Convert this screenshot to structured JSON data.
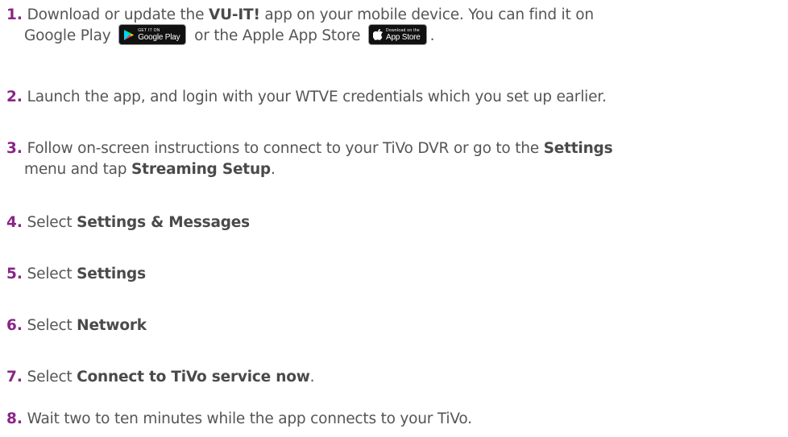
{
  "steps": [
    {
      "num": "1.",
      "t1": "Download or update the ",
      "b1": "VU-IT!",
      "t2": " app on your mobile device. You can find it on",
      "t3": "Google Play",
      "t4": "or the Apple App Store",
      "t5": "."
    },
    {
      "num": "2.",
      "t1": "Launch the app, and login with your WTVE credentials which you set up earlier."
    },
    {
      "num": "3.",
      "t1": "Follow on-screen instructions to connect to your TiVo DVR or go to the ",
      "b1": "Settings",
      "t2": "menu and tap ",
      "b2": "Streaming Setup",
      "t3": "."
    },
    {
      "num": "4.",
      "t1": "Select ",
      "b1": "Settings & Messages"
    },
    {
      "num": "5.",
      "t1": "Select ",
      "b1": "Settings"
    },
    {
      "num": "6.",
      "t1": "Select ",
      "b1": "Network"
    },
    {
      "num": "7.",
      "t1": "Select ",
      "b1": "Connect to TiVo service now",
      "t2": "."
    },
    {
      "num": "8.",
      "t1": "Wait two to ten minutes while the app connects to your TiVo."
    }
  ],
  "badges": {
    "google_play": {
      "top_text": "GET IT ON",
      "main_text": "Google Play",
      "icon": "google-play-icon"
    },
    "app_store": {
      "top_text": "Download on the",
      "main_text": "App Store",
      "icon": "apple-icon"
    }
  },
  "colors": {
    "step_number": "#8a2486",
    "text": "#555555",
    "badge_bg": "#111111"
  }
}
